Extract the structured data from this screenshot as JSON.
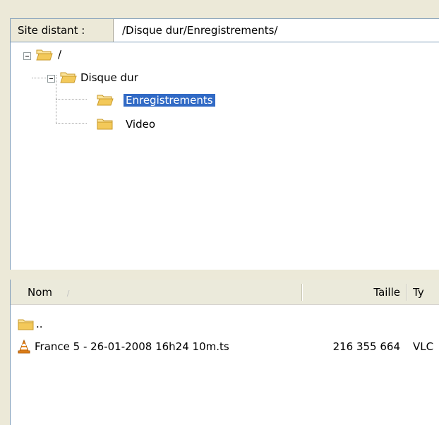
{
  "path_bar": {
    "label": "Site distant :",
    "value": "/Disque dur/Enregistrements/"
  },
  "tree": {
    "root": {
      "label": "/",
      "expanded": true
    },
    "disque_dur": {
      "label": "Disque dur",
      "expanded": true
    },
    "enregistrements": {
      "label": "Enregistrements",
      "selected": true
    },
    "video": {
      "label": "Video"
    }
  },
  "file_list": {
    "columns": {
      "name": "Nom",
      "size": "Taille",
      "type": "Ty"
    },
    "sort": {
      "column": "Nom",
      "direction": "ascending"
    },
    "rows": [
      {
        "name": "..",
        "size": "",
        "type": "",
        "icon": "folder-icon"
      },
      {
        "name": "France 5 - 26-01-2008 16h24 10m.ts",
        "size": "216 355 664",
        "type": "VLC",
        "icon": "vlc-cone-icon"
      }
    ]
  },
  "colors": {
    "selection": "#316ac5",
    "folder": "#f3c95a",
    "vlc_orange": "#f08a1c",
    "window_bg": "#ece9d8"
  }
}
